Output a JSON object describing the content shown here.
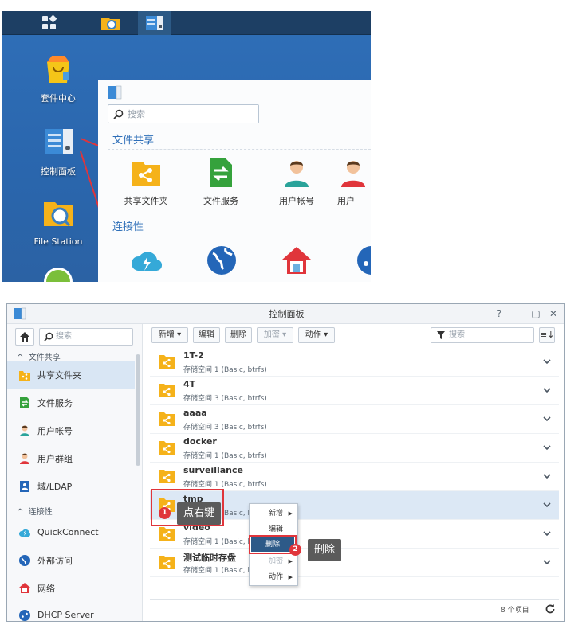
{
  "desktop": {
    "icons": [
      {
        "label": "套件中心"
      },
      {
        "label": "控制面板"
      },
      {
        "label": "File Station"
      }
    ],
    "control_panel_window": {
      "search_placeholder": "搜索",
      "sections": [
        {
          "title": "文件共享",
          "items": [
            {
              "label": "共享文件夹"
            },
            {
              "label": "文件服务"
            },
            {
              "label": "用户帐号"
            },
            {
              "label": "用户"
            }
          ]
        },
        {
          "title": "连接性"
        }
      ]
    }
  },
  "window": {
    "title": "控制面板",
    "controls": [
      "?",
      "—",
      "▢",
      "✕"
    ],
    "sidebar": {
      "search_placeholder": "搜索",
      "groups": [
        {
          "label": "文件共享",
          "items": [
            {
              "label": "共享文件夹",
              "icon": "share-folder-icon",
              "selected": true
            },
            {
              "label": "文件服务",
              "icon": "file-service-icon"
            },
            {
              "label": "用户帐号",
              "icon": "user-icon"
            },
            {
              "label": "用户群组",
              "icon": "group-icon"
            },
            {
              "label": "域/LDAP",
              "icon": "ldap-icon"
            }
          ]
        },
        {
          "label": "连接性",
          "items": [
            {
              "label": "QuickConnect",
              "icon": "quickconnect-icon"
            },
            {
              "label": "外部访问",
              "icon": "globe-icon"
            },
            {
              "label": "网络",
              "icon": "network-home-icon"
            },
            {
              "label": "DHCP Server",
              "icon": "dhcp-icon"
            }
          ]
        }
      ]
    },
    "toolbar": {
      "create": "新增 ▾",
      "edit": "编辑",
      "delete": "删除",
      "encrypt": "加密 ▾",
      "action": "动作 ▾",
      "filter_placeholder": "搜索"
    },
    "folders": [
      {
        "name": "1T-2",
        "desc": "存储空间 1 (Basic, btrfs)"
      },
      {
        "name": "4T",
        "desc": "存储空间 3 (Basic, btrfs)"
      },
      {
        "name": "aaaa",
        "desc": "存储空间 3 (Basic, btrfs)"
      },
      {
        "name": "docker",
        "desc": "存储空间 1 (Basic, btrfs)"
      },
      {
        "name": "surveillance",
        "desc": "存储空间 1 (Basic, btrfs)"
      },
      {
        "name": "tmp",
        "desc": "存储空间 1 (Basic, btrfs)",
        "selected": true
      },
      {
        "name": "video",
        "desc": "存储空间 1 (Basic, btrfs)"
      },
      {
        "name": "测试临时存盘",
        "desc": "存储空间 1 (Basic, btrfs)"
      }
    ],
    "status": {
      "count": "8 个项目"
    }
  },
  "context_menu": {
    "items": [
      {
        "label": "新增",
        "submenu": true
      },
      {
        "label": "编辑"
      },
      {
        "label": "删除",
        "highlighted": true
      },
      {
        "label": "加密",
        "submenu": true,
        "disabled": true
      },
      {
        "label": "动作",
        "submenu": true
      }
    ]
  },
  "annotations": {
    "step1_num": "1",
    "step1_text": "点右键",
    "step2_num": "2",
    "step2_text": "删除"
  },
  "colors": {
    "accent": "#2f6fb8",
    "folder": "#f5b21a",
    "highlight": "#e0353b"
  }
}
